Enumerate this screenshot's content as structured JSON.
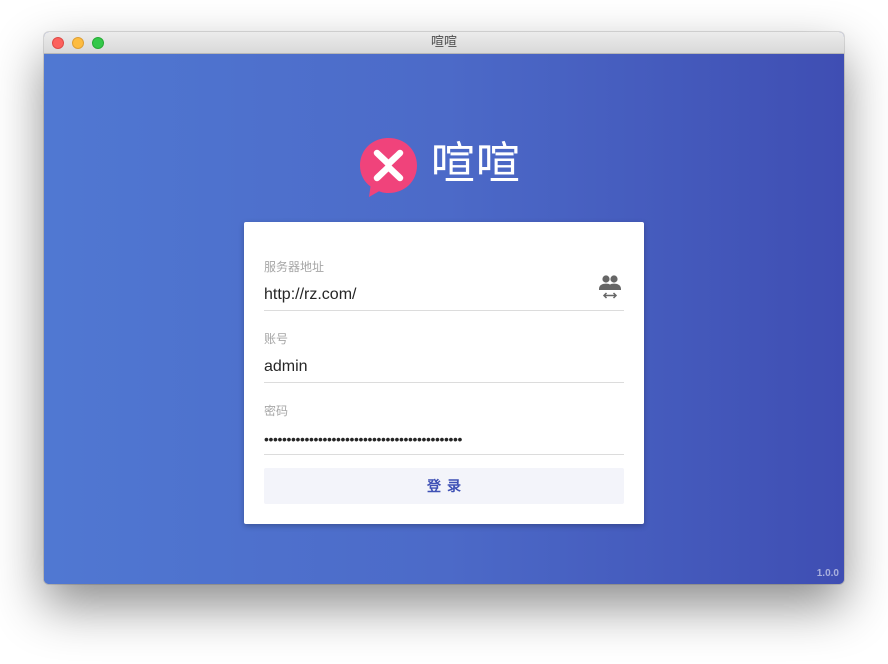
{
  "window": {
    "title": "喧喧"
  },
  "brand": {
    "name": "喧喧",
    "logo_icon": "xuanxuan-logo-icon",
    "logo_color": "#f0437b"
  },
  "form": {
    "server": {
      "label": "服务器地址",
      "value": "http://rz.com/",
      "switch_icon": "switch-user-icon"
    },
    "account": {
      "label": "账号",
      "value": "admin"
    },
    "password": {
      "label": "密码",
      "value": "••••••••••••••••••••••••••••••••••••••••••••"
    },
    "login_label": "登录"
  },
  "version": "1.0.0",
  "colors": {
    "background_start": "#5078d2",
    "background_end": "#3f4eb3",
    "accent": "#3f51b5",
    "button_bg": "#f3f4fa"
  }
}
